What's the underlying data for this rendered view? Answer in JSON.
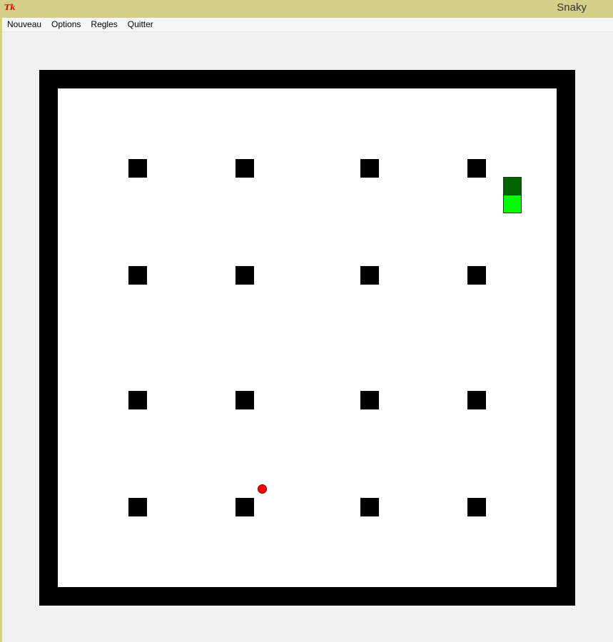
{
  "window": {
    "title": "Snaky",
    "icon_text": "Tk",
    "icon_name": "tk-feather-icon"
  },
  "menu": {
    "items": [
      "Nouveau",
      "Options",
      "Regles",
      "Quitter"
    ]
  },
  "colors": {
    "titlebar": "#d6cf8a",
    "wall": "#000000",
    "field": "#ffffff",
    "obstacle": "#000000",
    "snake_head": "#006400",
    "snake_body": "#00ff00",
    "food": "#ff0000"
  },
  "game": {
    "grid_size": 28,
    "obstacles_count": 16,
    "snake_length": 2,
    "food_count": 1
  }
}
